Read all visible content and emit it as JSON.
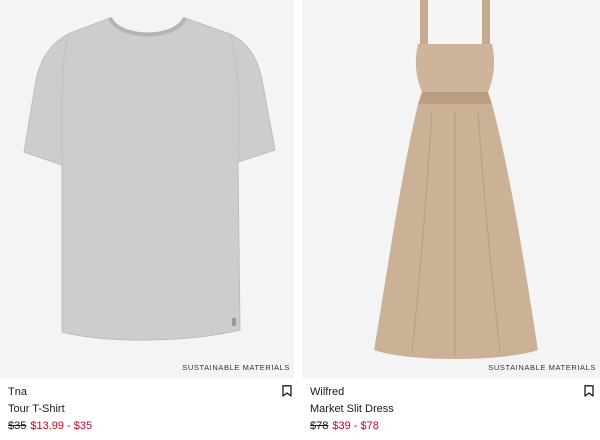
{
  "products": [
    {
      "brand": "Tna",
      "name": "Tour T-Shirt",
      "badge": "SUSTAINABLE MATERIALS",
      "price_original": "$35",
      "price_sale": "$13.99 - $35",
      "image": "grey-tshirt",
      "image_color": "#cfcfcf"
    },
    {
      "brand": "Wilfred",
      "name": "Market Slit Dress",
      "badge": "SUSTAINABLE MATERIALS",
      "price_original": "$78",
      "price_sale": "$39 - $78",
      "image": "beige-dress",
      "image_color": "#c9b096"
    }
  ],
  "icons": {
    "bookmark": "bookmark-icon"
  },
  "colors": {
    "sale": "#d0021b",
    "tile_bg": "#f4f4f4"
  }
}
